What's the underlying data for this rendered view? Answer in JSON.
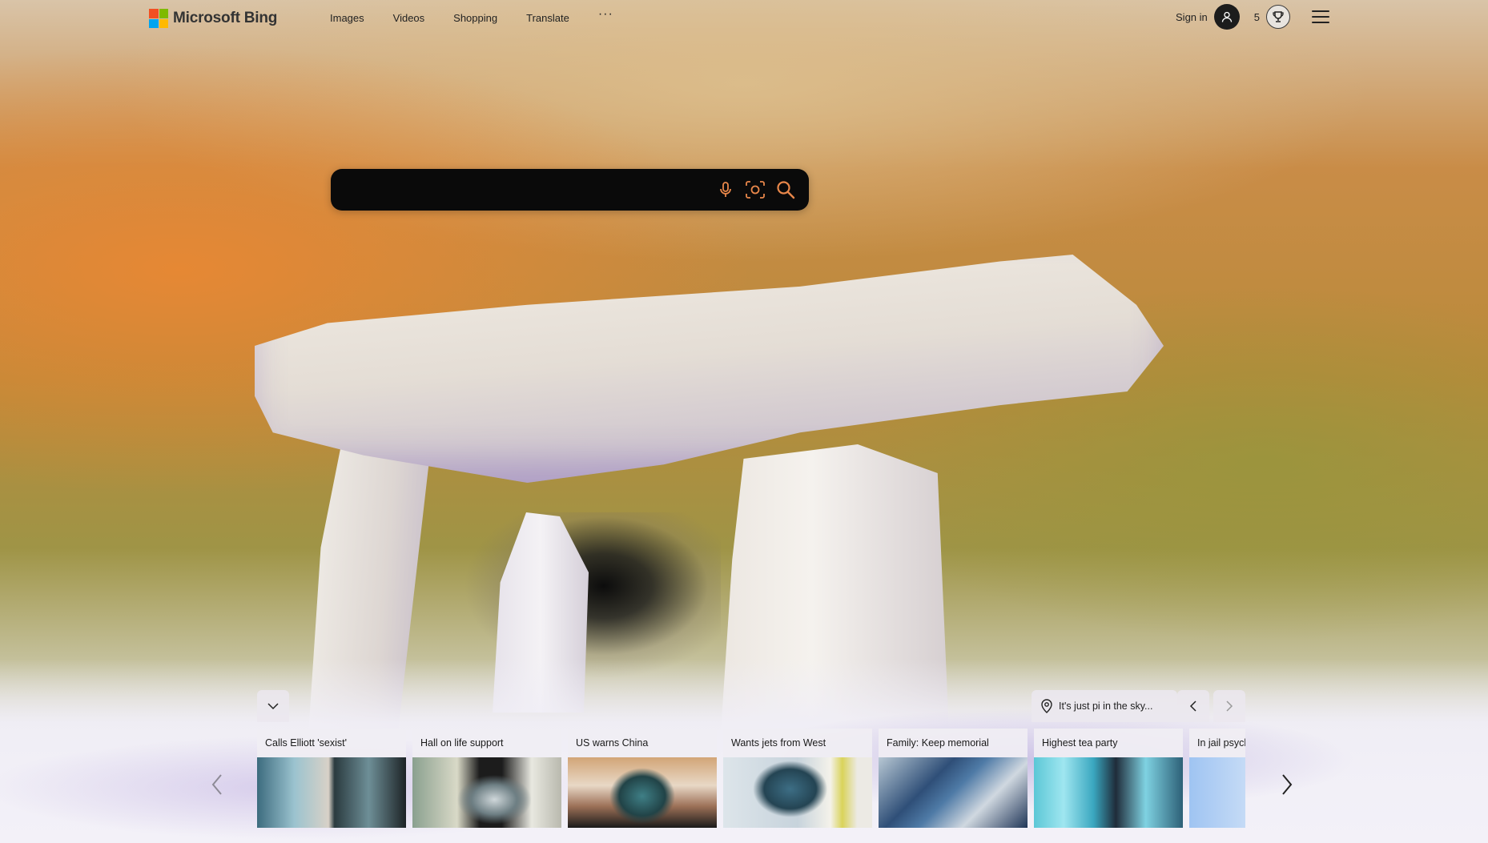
{
  "brand": {
    "logo_text": "Microsoft Bing",
    "colors": [
      "#f25022",
      "#7fba00",
      "#00a4ef",
      "#ffb900"
    ]
  },
  "nav": {
    "items": [
      "Images",
      "Videos",
      "Shopping",
      "Translate"
    ],
    "more": "···"
  },
  "header": {
    "signin_label": "Sign in",
    "points": "5"
  },
  "search": {
    "value": "",
    "icons": [
      "microphone-icon",
      "visual-search-icon",
      "search-icon"
    ]
  },
  "weather": {
    "text": "It's just pi in the sky..."
  },
  "news": {
    "cards": [
      {
        "title": "Calls Elliott 'sexist'"
      },
      {
        "title": "Hall on life support"
      },
      {
        "title": "US warns China"
      },
      {
        "title": "Wants jets from West"
      },
      {
        "title": "Family: Keep memorial"
      },
      {
        "title": "Highest tea party"
      },
      {
        "title": "In jail psychi"
      }
    ]
  }
}
